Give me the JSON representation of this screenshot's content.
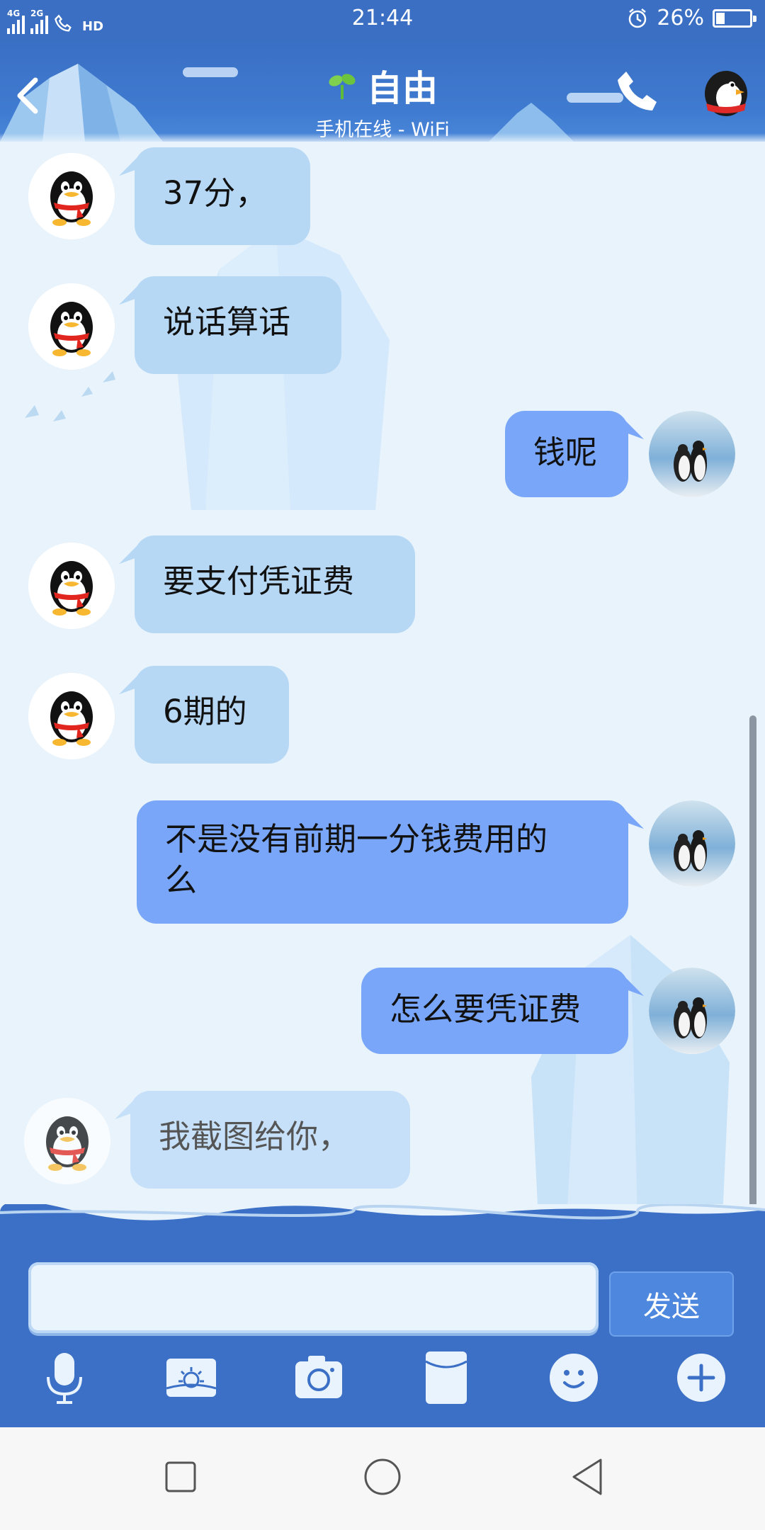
{
  "status_bar": {
    "network_1": "4G",
    "network_2": "2G",
    "call_badge": "HD",
    "time": "21:44",
    "battery_percent": "26%",
    "battery_level": 0.26,
    "icons": [
      "signal-icon",
      "phone-hd-icon",
      "alarm-icon",
      "battery-icon"
    ]
  },
  "header": {
    "contact_name": "自由",
    "status": "手机在线 - WiFi",
    "icons": [
      "back-icon",
      "sprout-icon",
      "phone-call-icon",
      "penguin-profile-icon"
    ]
  },
  "messages": [
    {
      "side": "left",
      "text": "37分，"
    },
    {
      "side": "left",
      "text": "说话算话"
    },
    {
      "side": "right",
      "text": "钱呢"
    },
    {
      "side": "left",
      "text": "要支付凭证费"
    },
    {
      "side": "left",
      "text": "6期的"
    },
    {
      "side": "right",
      "text_line1": "不是没有前期一分钱费用的",
      "text_line2": "么"
    },
    {
      "side": "right",
      "text": "怎么要凭证费"
    },
    {
      "side": "left",
      "text": "我截图给你，"
    }
  ],
  "input": {
    "value": "",
    "placeholder": "",
    "send_label": "发送"
  },
  "toolbar": {
    "items": [
      "voice-icon",
      "image-icon",
      "camera-icon",
      "red-packet-icon",
      "emoji-icon",
      "plus-icon"
    ]
  },
  "nav_bar": {
    "items": [
      "recent-apps-icon",
      "home-icon",
      "back-nav-icon"
    ]
  },
  "colors": {
    "header_blue": "#3a6fc4",
    "bubble_left": "#b6d8f5",
    "bubble_right": "#79a6f8",
    "chat_bg": "#e8f3fc"
  }
}
